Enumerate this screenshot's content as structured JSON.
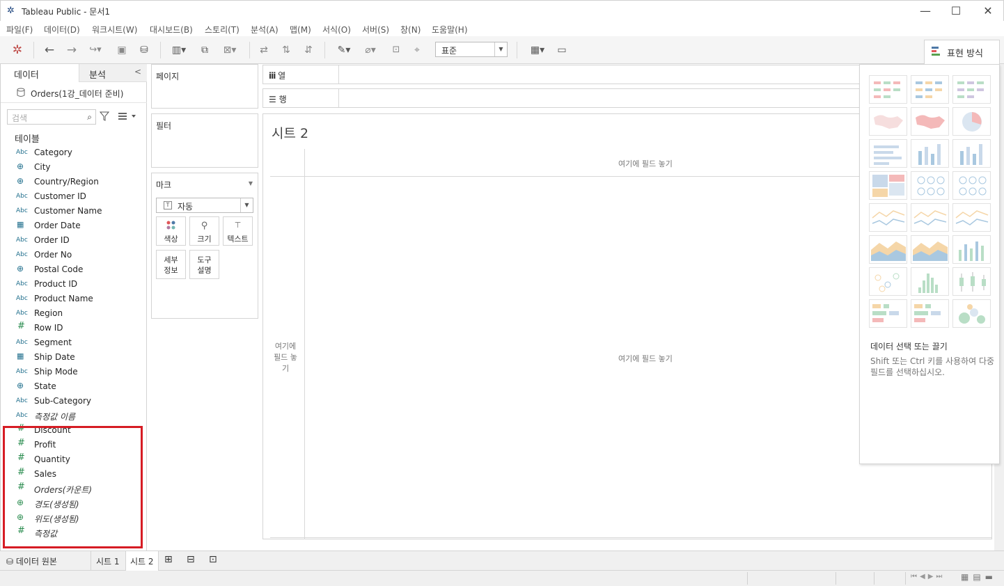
{
  "window": {
    "title": "Tableau Public - 문서1"
  },
  "menu": [
    "파일(F)",
    "데이터(D)",
    "워크시트(W)",
    "대시보드(B)",
    "스토리(T)",
    "분석(A)",
    "맵(M)",
    "서식(O)",
    "서버(S)",
    "창(N)",
    "도움말(H)"
  ],
  "toolbar": {
    "fit_value": "표준",
    "show_me_label": "표현 방식"
  },
  "data_pane": {
    "tab_data": "데이터",
    "tab_analysis": "분석",
    "datasource": "Orders(1강_데이터 준비)",
    "search_placeholder": "검색",
    "tables_header": "테이블",
    "fields": [
      {
        "type": "Abc",
        "name": "Category"
      },
      {
        "type": "globe",
        "name": "City"
      },
      {
        "type": "globe",
        "name": "Country/Region"
      },
      {
        "type": "Abc",
        "name": "Customer ID"
      },
      {
        "type": "Abc",
        "name": "Customer Name"
      },
      {
        "type": "calendar",
        "name": "Order Date"
      },
      {
        "type": "Abc",
        "name": "Order ID"
      },
      {
        "type": "Abc",
        "name": "Order No"
      },
      {
        "type": "globe",
        "name": "Postal Code"
      },
      {
        "type": "Abc",
        "name": "Product ID"
      },
      {
        "type": "Abc",
        "name": "Product Name"
      },
      {
        "type": "Abc",
        "name": "Region"
      },
      {
        "type": "hash",
        "name": "Row ID"
      },
      {
        "type": "Abc",
        "name": "Segment"
      },
      {
        "type": "calendar",
        "name": "Ship Date"
      },
      {
        "type": "Abc",
        "name": "Ship Mode"
      },
      {
        "type": "globe",
        "name": "State"
      },
      {
        "type": "Abc",
        "name": "Sub-Category"
      },
      {
        "type": "Abc",
        "name": "측정값 이름",
        "italic": true
      },
      {
        "type": "hash",
        "name": "Discount"
      },
      {
        "type": "hash",
        "name": "Profit"
      },
      {
        "type": "hash",
        "name": "Quantity"
      },
      {
        "type": "hash",
        "name": "Sales"
      },
      {
        "type": "hash",
        "name": "Orders(카운트)",
        "italic": true
      },
      {
        "type": "globe",
        "name": "경도(생성됨)",
        "italic": true
      },
      {
        "type": "globe",
        "name": "위도(생성됨)",
        "italic": true
      },
      {
        "type": "hash",
        "name": "측정값",
        "italic": true
      }
    ]
  },
  "cards": {
    "pages": "페이지",
    "filters": "필터",
    "marks": "마크",
    "mark_type": "자동",
    "color": "색상",
    "size": "크기",
    "text": "텍스트",
    "detail": "세부\n정보",
    "tooltip": "도구\n설명"
  },
  "shelves": {
    "columns": "열",
    "rows": "행"
  },
  "canvas": {
    "sheet_title": "시트 2",
    "drop_top": "여기에 필드 놓기",
    "drop_center": "여기에 필드 놓기",
    "drop_left": "여기에 필드 놓기"
  },
  "show_me": {
    "title": "데이터 선택 또는 끌기",
    "description": "Shift 또는 Ctrl 키를 사용하여 다중 필드를 선택하십시오."
  },
  "sheet_tabs": {
    "datasource": "데이터 원본",
    "sheets": [
      "시트 1",
      "시트 2"
    ],
    "active": "시트 2"
  },
  "colors": {
    "highlight": "#d61c24",
    "field_dim": "#1f6e8c",
    "field_measure": "#2a8c4f"
  }
}
